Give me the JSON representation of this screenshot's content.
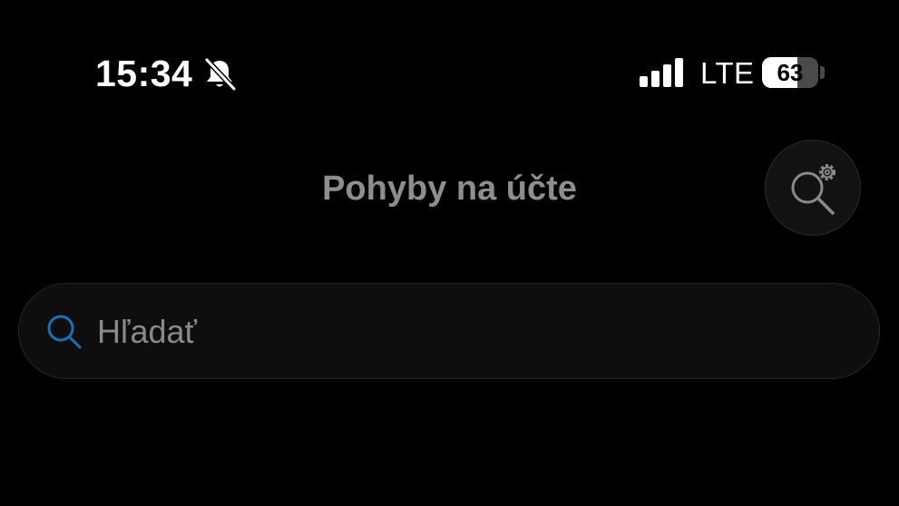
{
  "status_bar": {
    "time": "15:34",
    "network": "LTE",
    "battery_level": "63",
    "battery_fraction": 0.63,
    "icons": [
      "bell-slash-icon",
      "signal-bars-icon",
      "battery-icon"
    ]
  },
  "header": {
    "title": "Pohyby na účte",
    "action_icon": "search-settings-icon"
  },
  "search": {
    "placeholder": "Hľadať",
    "value": "",
    "icon": "search-icon"
  },
  "colors": {
    "background": "#000000",
    "title_text": "#8e8e8e",
    "accent": "#1f6fb5",
    "input_surface": "#0e0e0e"
  }
}
